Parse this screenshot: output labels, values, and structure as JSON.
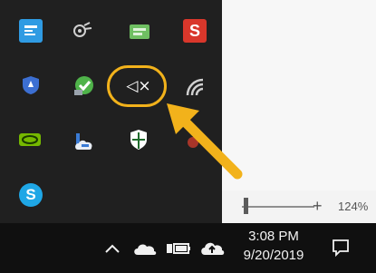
{
  "zoom": {
    "level": "124%",
    "plus": "+"
  },
  "tray_flyout": {
    "icons": [
      {
        "name": "tray-app-blue-icon",
        "color": "#2f9be3"
      },
      {
        "name": "satellite-icon",
        "color": "#cccccc"
      },
      {
        "name": "green-app-icon",
        "color": "#6fbf62"
      },
      {
        "name": "tray-red-s-icon",
        "color": "#d9372b",
        "label": "S"
      },
      {
        "name": "shield-app-icon",
        "color": "#3c6fd2"
      },
      {
        "name": "green-sync-icon",
        "color": "#4fb34a"
      },
      {
        "name": "speaker-muted-icon",
        "color": "#ffffff",
        "label": "◁×"
      },
      {
        "name": "wifi-icon",
        "color": "#cfcfcf"
      },
      {
        "name": "nvidia-icon",
        "color": "#76b900"
      },
      {
        "name": "cloud-tray-icon",
        "color": "#3a7bd5"
      },
      {
        "name": "defender-shield-icon",
        "color": "#ffffff"
      },
      {
        "name": "red-dot-icon",
        "color": "#c03a2b"
      },
      {
        "name": "skype-icon",
        "color": "#1fa7e6",
        "label": "S"
      }
    ],
    "highlight_color": "#f2b21b"
  },
  "taskbar": {
    "time": "3:08 PM",
    "date": "9/20/2019",
    "show_hidden_icon": "chevron-up-icon",
    "tray_icons": [
      "onedrive-icon",
      "battery-icon",
      "cloud-upload-icon"
    ],
    "notification_icon": "action-center-icon"
  }
}
